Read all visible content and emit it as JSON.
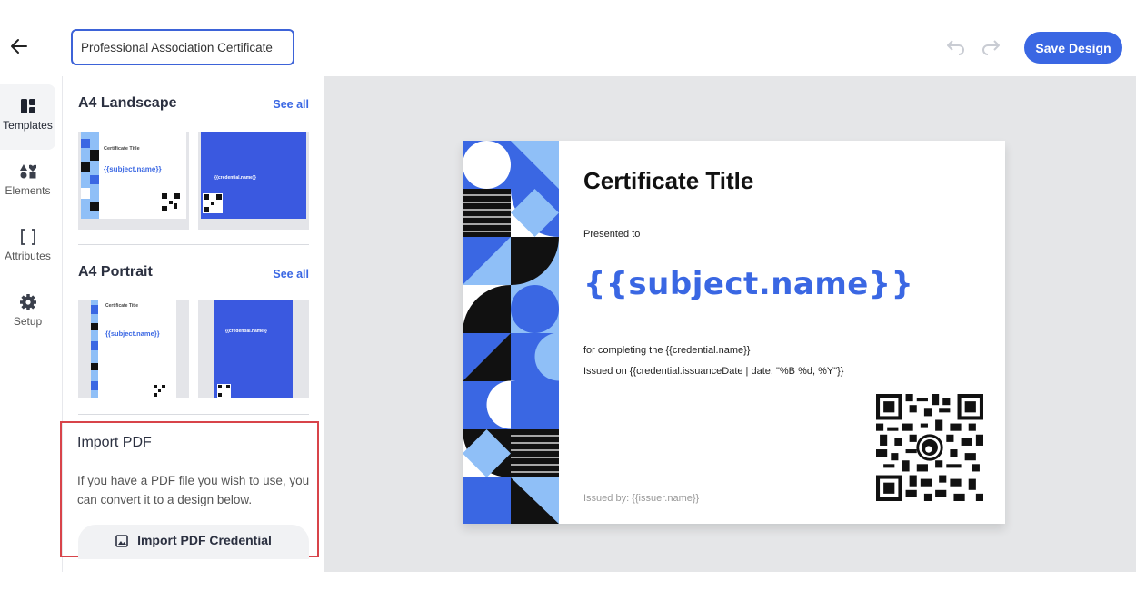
{
  "header": {
    "back_icon": "arrow-left-icon",
    "design_name": "Professional Association Certificate",
    "undo_icon": "undo-icon",
    "redo_icon": "redo-icon",
    "save_label": "Save Design",
    "accent_color": "#3a67e3"
  },
  "rail": {
    "items": [
      {
        "label": "Templates",
        "icon": "templates-icon",
        "active": true
      },
      {
        "label": "Elements",
        "icon": "shapes-icon",
        "active": false
      },
      {
        "label": "Attributes",
        "icon": "brackets-icon",
        "active": false
      },
      {
        "label": "Setup",
        "icon": "gear-icon",
        "active": false
      }
    ]
  },
  "panel": {
    "sections": [
      {
        "title": "A4 Landscape",
        "see_all": "See all",
        "templates": [
          {
            "title": "Certificate Title",
            "name": "{{subject.name}}",
            "style": "white"
          },
          {
            "title": "{{credential.name}}",
            "style": "blue"
          }
        ]
      },
      {
        "title": "A4 Portrait",
        "see_all": "See all",
        "templates": [
          {
            "title": "Certificate Title",
            "name": "{{subject.name}}",
            "style": "white"
          },
          {
            "title": "{{credential.name}}",
            "style": "blue"
          }
        ]
      }
    ],
    "import": {
      "title": "Import PDF",
      "description": "If you have a PDF file you wish to use, you can convert it to a design below.",
      "button_label": "Import PDF Credential",
      "button_icon": "image-icon",
      "highlight_color": "#d8444a"
    }
  },
  "certificate": {
    "title": "Certificate Title",
    "presented_to": "Presented to",
    "subject_name": "{{subject.name}}",
    "completing": "for completing the {{credential.name}}",
    "issued_on": "Issued on {{credential.issuanceDate | date: \"%B %d, %Y\"}}",
    "issued_by": "Issued by: {{issuer.name}}",
    "qr_icon": "qr-code-icon",
    "pattern_colors": [
      "#3a67e3",
      "#8fbff7",
      "#111111",
      "#ffffff"
    ]
  }
}
